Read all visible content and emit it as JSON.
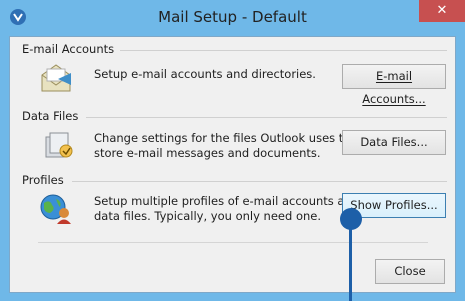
{
  "window": {
    "title": "Mail Setup - Default",
    "close_glyph": "✕"
  },
  "email_accounts": {
    "group_label": "E-mail Accounts",
    "description": "Setup e-mail accounts and directories.",
    "button_label": "E-mail Accounts..."
  },
  "data_files": {
    "group_label": "Data Files",
    "description_line1": "Change settings for the files Outlook uses to",
    "description_line2": "store e-mail messages and documents.",
    "button_label": "Data Files..."
  },
  "profiles": {
    "group_label": "Profiles",
    "description_line1": "Setup multiple profiles of e-mail accounts and",
    "description_line2": "data files. Typically, you only need one.",
    "button_label": "Show Profiles..."
  },
  "footer": {
    "close_label": "Close"
  },
  "icons": {
    "title": "mail-setup-icon",
    "email": "envelope-icon",
    "data_files": "data-files-icon",
    "profiles": "profiles-globe-icon"
  }
}
